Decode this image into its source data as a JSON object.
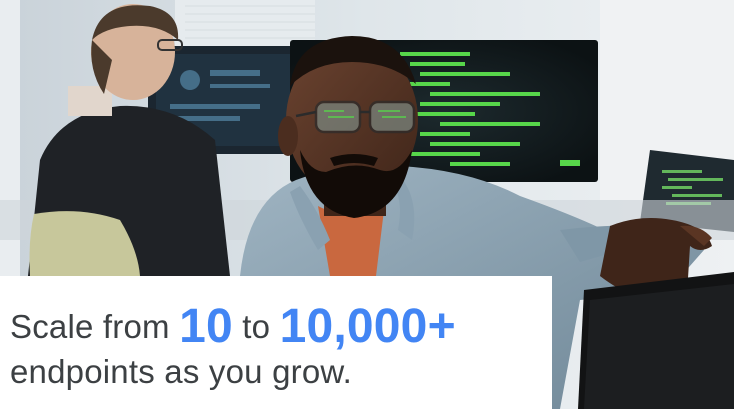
{
  "headline": {
    "prefix": "Scale from ",
    "num_from": "10",
    "middle": " to ",
    "num_to": "10,000+",
    "line2": "endpoints as you grow."
  },
  "colors": {
    "accent": "#4285f4",
    "text": "#3c4043",
    "panel": "#ffffff"
  },
  "photo": {
    "icon": "office-developer-photo"
  }
}
